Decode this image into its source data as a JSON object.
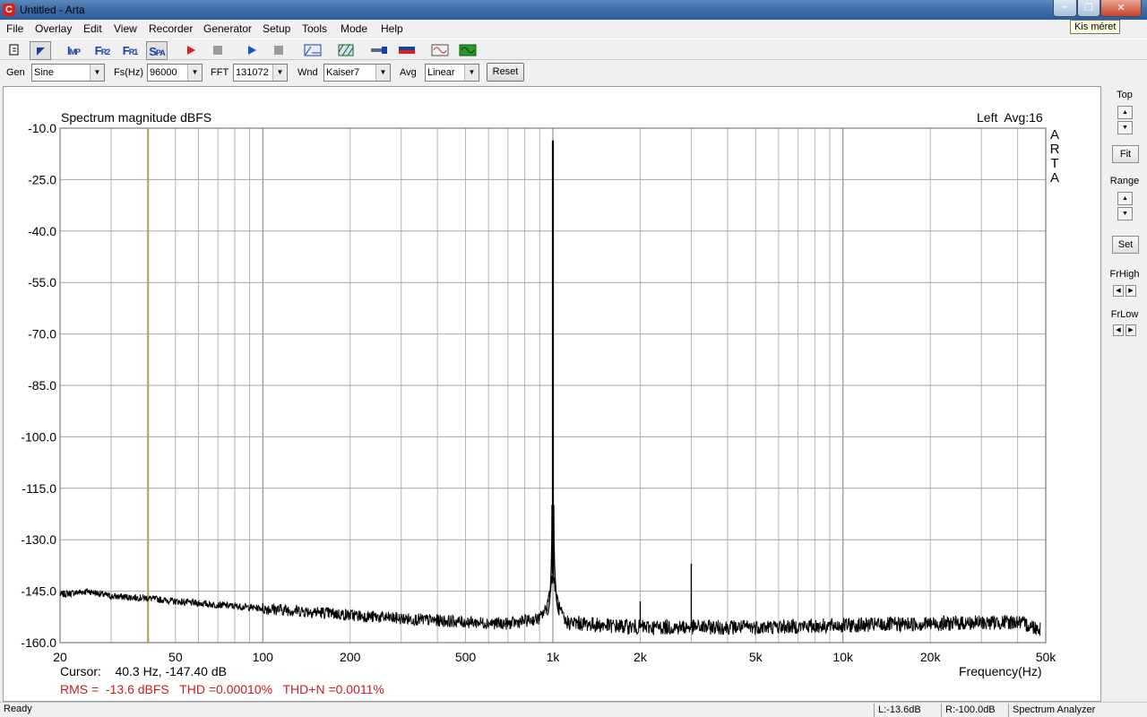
{
  "window": {
    "title": "Untitled - Arta",
    "icon_glyph": "C",
    "tooltip": "Kis méret",
    "controls": [
      "minimize-icon",
      "restore-icon",
      "close-icon"
    ]
  },
  "menu": [
    "File",
    "Overlay",
    "Edit",
    "View",
    "Recorder",
    "Generator",
    "Setup",
    "Tools",
    "Mode",
    "Help"
  ],
  "toolbar": {
    "buttons": [
      {
        "name": "new-file-icon",
        "text": ""
      },
      {
        "name": "cursor-icon",
        "text": ""
      },
      {
        "name": "imp-mode-button",
        "text": "IMP"
      },
      {
        "name": "fr2-mode-button",
        "text": "FR2"
      },
      {
        "name": "fr1-mode-button",
        "text": "FR1"
      },
      {
        "name": "spa-mode-button",
        "text": "SPA"
      },
      {
        "name": "record-icon",
        "text": ""
      },
      {
        "name": "stop-icon",
        "text": ""
      },
      {
        "name": "play-icon",
        "text": ""
      },
      {
        "name": "stop2-icon",
        "text": ""
      },
      {
        "name": "abc-icon",
        "text": ""
      },
      {
        "name": "hatch-icon",
        "text": ""
      },
      {
        "name": "probe-icon",
        "text": ""
      },
      {
        "name": "level-meter-icon",
        "text": ""
      },
      {
        "name": "sine-generator-icon",
        "text": ""
      },
      {
        "name": "scope-icon",
        "text": ""
      }
    ],
    "accent": "#1a3ea8",
    "record_color": "#e0201b",
    "play_color": "#1a4fd0"
  },
  "params": {
    "gen_label": "Gen",
    "gen_value": "Sine",
    "fs_label": "Fs(Hz)",
    "fs_value": "96000",
    "fft_label": "FFT",
    "fft_value": "131072",
    "wnd_label": "Wnd",
    "wnd_value": "Kaiser7",
    "avg_label": "Avg",
    "avg_value": "Linear",
    "reset_label": "Reset"
  },
  "right_panel": {
    "top_label": "Top",
    "fit_label": "Fit",
    "range_label": "Range",
    "set_label": "Set",
    "frhigh_label": "FrHigh",
    "frlow_label": "FrLow"
  },
  "plot": {
    "title": "Spectrum magnitude dBFS",
    "channel_info": "Left  Avg:16",
    "watermark_letters": [
      "A",
      "R",
      "T",
      "A"
    ],
    "x_axis_label": "Frequency(Hz)",
    "cursor_text": "Cursor:    40.3 Hz, -147.40 dB",
    "stats_text": "RMS =  -13.6 dBFS   THD =0.00010%   THD+N =0.0011%",
    "stats_color": "#c81e1e",
    "cursor_line_color": "#b8a63c"
  },
  "chart_data": {
    "type": "line",
    "title": "Spectrum magnitude dBFS",
    "xlabel": "Frequency(Hz)",
    "ylabel": "",
    "x_scale": "log",
    "xlim": [
      20,
      50000
    ],
    "ylim": [
      -160,
      -10
    ],
    "grid": true,
    "y_ticks": [
      -10.0,
      -25.0,
      -40.0,
      -55.0,
      -70.0,
      -85.0,
      -100.0,
      -115.0,
      -130.0,
      -145.0,
      -160.0
    ],
    "y_tick_labels": [
      "-10.0",
      "-25.0",
      "-40.0",
      "-55.0",
      "-70.0",
      "-85.0",
      "-100.0",
      "-115.0",
      "-130.0",
      "-145.0",
      "-160.0"
    ],
    "x_ticks": [
      20,
      50,
      100,
      200,
      500,
      1000,
      2000,
      5000,
      10000,
      20000,
      50000
    ],
    "x_tick_labels": [
      "20",
      "50",
      "100",
      "200",
      "500",
      "1k",
      "2k",
      "5k",
      "10k",
      "20k",
      "50k"
    ],
    "cursor": {
      "x": 40.3,
      "y": -147.4
    },
    "series": [
      {
        "color": "#000000",
        "noise_floor": {
          "x": [
            20,
            25,
            30,
            40,
            50,
            70,
            100,
            150,
            200,
            300,
            500,
            700,
            900,
            950,
            1000,
            1050,
            1100,
            1500,
            2000,
            3000,
            5000,
            10000,
            20000,
            40000,
            48000
          ],
          "y": [
            -146,
            -145,
            -146.5,
            -147,
            -148,
            -149,
            -150,
            -151,
            -152,
            -153,
            -154,
            -154.5,
            -153,
            -150,
            -140,
            -150,
            -154,
            -155,
            -155.5,
            -155.5,
            -155.5,
            -155,
            -154.5,
            -154,
            -156
          ]
        },
        "peaks": [
          {
            "x": 1000,
            "y": -13.6
          },
          {
            "x": 2000,
            "y": -148
          },
          {
            "x": 3000,
            "y": -137
          }
        ]
      }
    ]
  },
  "status": {
    "ready": "Ready",
    "left_level": "L:-13.6dB",
    "right_level": "R:-100.0dB",
    "mode": "Spectrum Analyzer"
  }
}
